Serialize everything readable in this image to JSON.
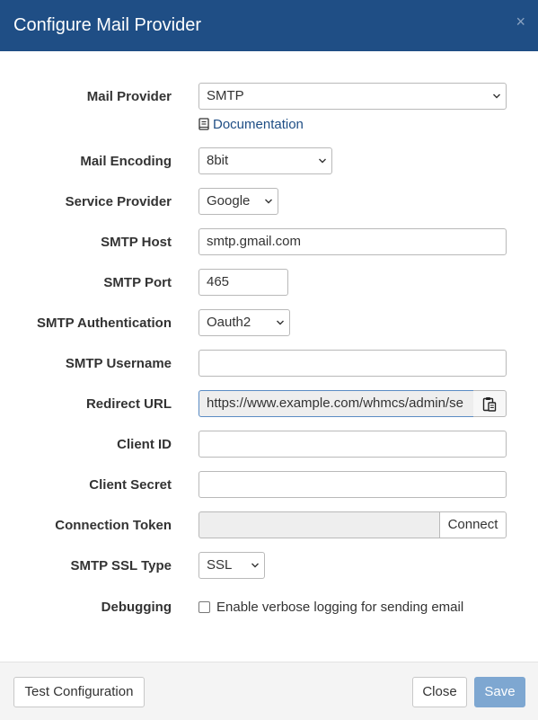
{
  "modal": {
    "title": "Configure Mail Provider",
    "close_glyph": "×"
  },
  "form": {
    "mail_provider": {
      "label": "Mail Provider",
      "value": "SMTP"
    },
    "documentation": {
      "label": "Documentation",
      "icon": "book-icon"
    },
    "mail_encoding": {
      "label": "Mail Encoding",
      "value": "8bit"
    },
    "service_provider": {
      "label": "Service Provider",
      "value": "Google"
    },
    "smtp_host": {
      "label": "SMTP Host",
      "value": "smtp.gmail.com"
    },
    "smtp_port": {
      "label": "SMTP Port",
      "value": "465"
    },
    "smtp_auth": {
      "label": "SMTP Authentication",
      "value": "Oauth2"
    },
    "smtp_username": {
      "label": "SMTP Username",
      "value": ""
    },
    "redirect_url": {
      "label": "Redirect URL",
      "value": "https://www.example.com/whmcs/admin/se",
      "copy_icon": "clipboard-icon"
    },
    "client_id": {
      "label": "Client ID",
      "value": ""
    },
    "client_secret": {
      "label": "Client Secret",
      "value": ""
    },
    "connection_token": {
      "label": "Connection Token",
      "value": "",
      "button": "Connect"
    },
    "ssl_type": {
      "label": "SMTP SSL Type",
      "value": "SSL"
    },
    "debugging": {
      "label": "Debugging",
      "checkbox_label": "Enable verbose logging for sending email",
      "checked": false
    }
  },
  "footer": {
    "test_button": "Test Configuration",
    "close_button": "Close",
    "save_button": "Save"
  },
  "colors": {
    "header_bg": "#1f4e85",
    "link": "#1f4e85",
    "primary_button": "#7ea7d1"
  }
}
